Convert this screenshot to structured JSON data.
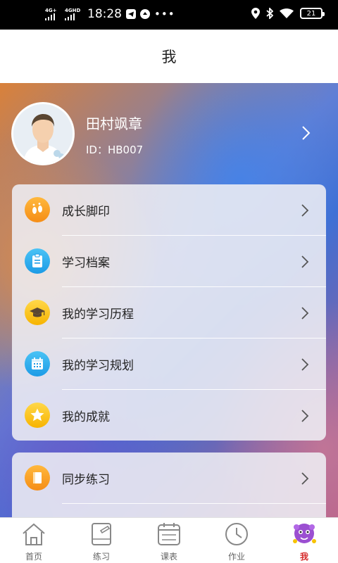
{
  "status_bar": {
    "signal1": "4G+",
    "signal2": "4GHD",
    "time": "18:28",
    "more": "•••",
    "battery": "21"
  },
  "header": {
    "title": "我"
  },
  "profile": {
    "name": "田村飒章",
    "id_text": "ID：HB007"
  },
  "menu": {
    "items": [
      {
        "label": "成长脚印",
        "icon": "footprints-icon"
      },
      {
        "label": "学习档案",
        "icon": "clipboard-icon"
      },
      {
        "label": "我的学习历程",
        "icon": "graduation-cap-icon"
      },
      {
        "label": "我的学习规划",
        "icon": "calendar-icon"
      },
      {
        "label": "我的成就",
        "icon": "star-icon"
      }
    ]
  },
  "menu2": {
    "items": [
      {
        "label": "同步练习",
        "icon": "book-icon"
      }
    ]
  },
  "tabbar": {
    "tabs": [
      {
        "label": "首页",
        "icon": "home-icon"
      },
      {
        "label": "练习",
        "icon": "exercise-book-icon"
      },
      {
        "label": "课表",
        "icon": "schedule-icon"
      },
      {
        "label": "作业",
        "icon": "clock-icon"
      },
      {
        "label": "我",
        "icon": "mascot-icon",
        "active": true
      }
    ]
  },
  "colors": {
    "active_tab": "#d62a2a",
    "icon_orange": "#f5a623",
    "icon_blue": "#1c9be6",
    "icon_yellow": "#f7c300"
  }
}
